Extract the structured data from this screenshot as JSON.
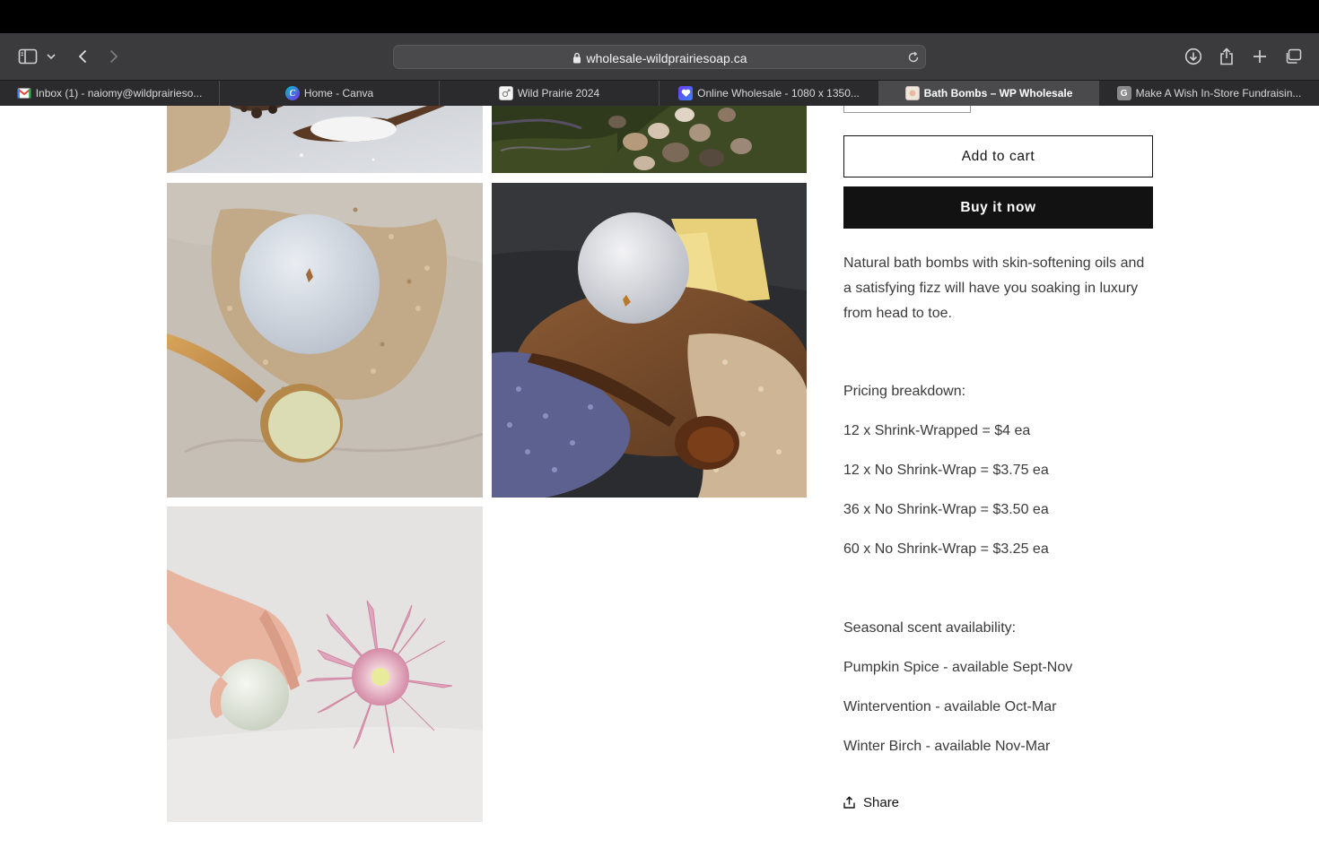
{
  "browser": {
    "url": "wholesale-wildprairiesoap.ca",
    "tabs": [
      {
        "title": "Inbox (1) - naiomy@wildprairieso...",
        "favicon": "gmail-icon",
        "active": false
      },
      {
        "title": "Home - Canva",
        "favicon": "canva-icon",
        "active": false
      },
      {
        "title": "Wild Prairie 2024",
        "favicon": "document-icon",
        "active": false
      },
      {
        "title": "Online Wholesale - 1080 x 1350...",
        "favicon": "heart-icon",
        "active": false
      },
      {
        "title": "Bath Bombs – WP Wholesale",
        "favicon": "store-icon",
        "active": true
      },
      {
        "title": "Make A Wish In-Store Fundraisin...",
        "favicon": "g-letter-icon",
        "active": false
      }
    ]
  },
  "product": {
    "add_to_cart_label": "Add to cart",
    "buy_now_label": "Buy it now",
    "description": "Natural bath bombs with skin-softening oils and a satisfying fizz will have you soaking in luxury from head to toe.",
    "pricing_heading": "Pricing breakdown:",
    "pricing": [
      "12 x Shrink-Wrapped = $4 ea",
      "12 x No Shrink-Wrap = $3.75 ea",
      "36 x No Shrink-Wrap = $3.50 ea",
      "60 x No Shrink-Wrap = $3.25 ea"
    ],
    "seasonal_heading": "Seasonal scent availability:",
    "seasonal": [
      "Pumpkin Spice - available Sept-Nov",
      "Wintervention - available Oct-Mar",
      "Winter Birch - available Nov-Mar"
    ],
    "share_label": "Share"
  },
  "gallery": [
    {
      "name": "bath-bomb-photo-salt-scoop"
    },
    {
      "name": "bath-bomb-photo-stones"
    },
    {
      "name": "bath-bomb-photo-oats-spoon"
    },
    {
      "name": "bath-bomb-photo-lavender-board"
    },
    {
      "name": "bath-bomb-photo-hand-flower"
    }
  ],
  "colors": {
    "button_dark": "#121212",
    "text": "#3a3a3a",
    "toolbar": "#3b3b3d",
    "tabstrip": "#2b2b2d"
  }
}
